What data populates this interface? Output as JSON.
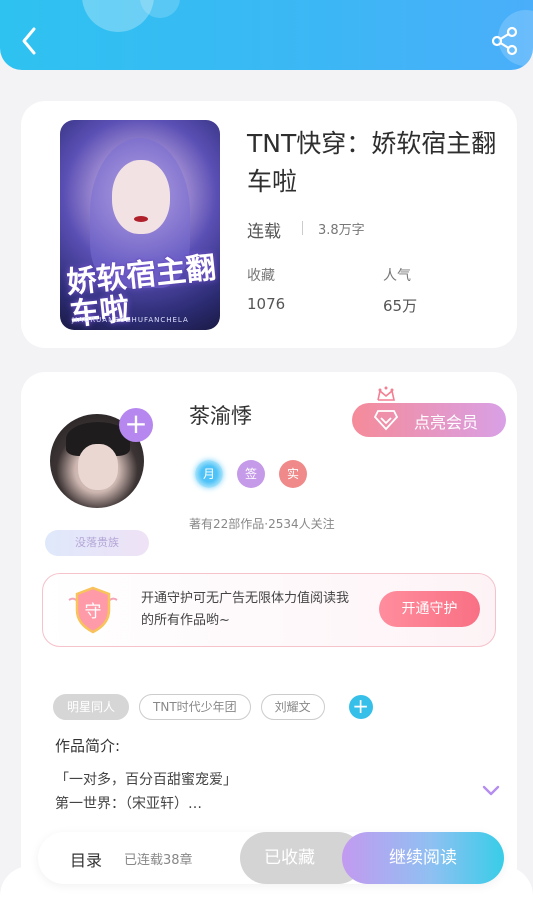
{
  "header": {
    "back_icon": "chevron-left-icon",
    "share_icon": "share-icon",
    "gradient_start": "#2ec2f0",
    "gradient_end": "#4aaefa"
  },
  "book": {
    "title": "TNT快穿：娇软宿主翻车啦",
    "cover_title": "娇软宿主翻车啦",
    "cover_subtitle": "JIAORUANSUZHUFANCHELA",
    "status": "连载",
    "word_count": "3.8万字",
    "favorites_label": "收藏",
    "favorites_value": "1076",
    "popularity_label": "人气",
    "popularity_value": "65万"
  },
  "author": {
    "name": "茶渝悸",
    "follow_icon": "plus-icon",
    "vip_button": "点亮会员",
    "badges": [
      "月",
      "签",
      "实"
    ],
    "stats": "著有22部作品·2534人关注",
    "rank_tag": "没落贵族"
  },
  "guard": {
    "text": "开通守护可无广告无限体力值阅读我的所有作品哟~",
    "icon_char": "守",
    "button": "开通守护"
  },
  "tags": [
    "明星同人",
    "TNT时代少年团",
    "刘耀文"
  ],
  "intro": {
    "label": "作品简介:",
    "line1": "「一对多，百分百甜蜜宠爱」",
    "line2": "第一世界：（宋亚轩）…"
  },
  "bottom_bar": {
    "toc_label": "目录",
    "toc_count": "已连载38章",
    "collect_button": "已收藏",
    "read_button": "继续阅读"
  }
}
